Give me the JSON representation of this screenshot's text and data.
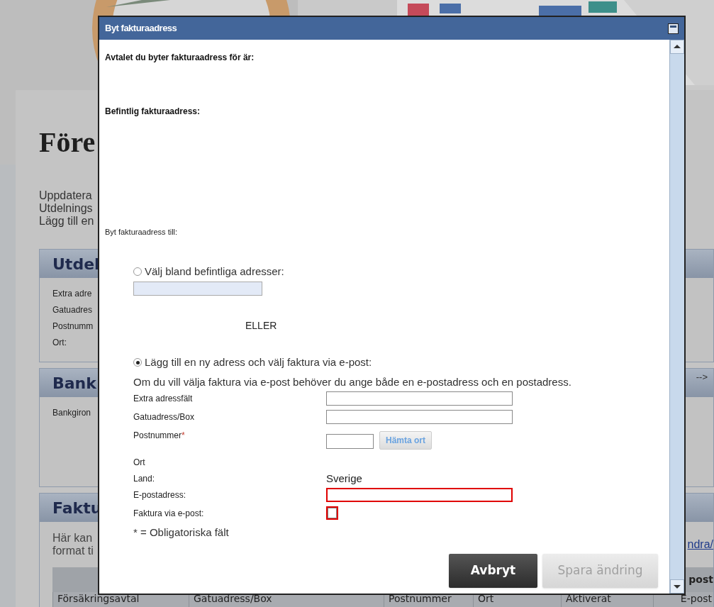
{
  "background_page": {
    "heading": "Före",
    "intro_lines": [
      "Uppdatera",
      "Utdelnings",
      "Lägg till en"
    ],
    "sections": [
      {
        "title": "Utdel",
        "lines": [
          "Extra adre",
          "Gatuadres",
          "Postnumm",
          "Ort:"
        ]
      },
      {
        "title": "Bank",
        "lines": [
          "Bankgiron"
        ],
        "side_text": "-->"
      },
      {
        "title": "Faktu",
        "lines": [
          "Här kan",
          "format ti"
        ],
        "side_link": "ndra/"
      }
    ],
    "table": {
      "header_fragment": "post",
      "columns": [
        "Försäkringsavtal",
        "Gatuadress/Box",
        "Postnummer",
        "Ort",
        "Aktiverat",
        "E-post"
      ]
    }
  },
  "dialog": {
    "title": "Byt fakturaadress",
    "agreement_label": "Avtalet du byter fakturaadress för är:",
    "current_address_label": "Befintlig fakturaadress:",
    "change_to_label": "Byt fakturaadress till:",
    "options": [
      {
        "label": "Välj bland befintliga adresser:",
        "selected": false
      },
      {
        "label": "Lägg till en ny adress och välj faktura via e-post:",
        "selected": true
      }
    ],
    "separator": "ELLER",
    "info": "Om du vill välja faktura via e-post behöver du ange både en e-postadress och en postadress.",
    "fields": [
      {
        "kind": "input",
        "label": "Extra adressfält",
        "invalid": false
      },
      {
        "kind": "input",
        "label": "Gatuadress/Box",
        "invalid": false
      },
      {
        "kind": "zip",
        "label": "Postnummer",
        "required_mark": "*",
        "button": "Hämta ort",
        "invalid": false
      },
      {
        "kind": "text",
        "label": "Ort"
      },
      {
        "kind": "text",
        "label": "Land:",
        "value": "Sverige"
      },
      {
        "kind": "input",
        "label": "E-postadress:",
        "invalid": true
      },
      {
        "kind": "checkbox",
        "label": "Faktura via e-post:",
        "checked": false,
        "invalid": true
      }
    ],
    "required_note": "* = Obligatoriska fält",
    "buttons": [
      {
        "label": "Avbryt",
        "disabled": false
      },
      {
        "label": "Spara ändring",
        "disabled": true
      }
    ]
  }
}
